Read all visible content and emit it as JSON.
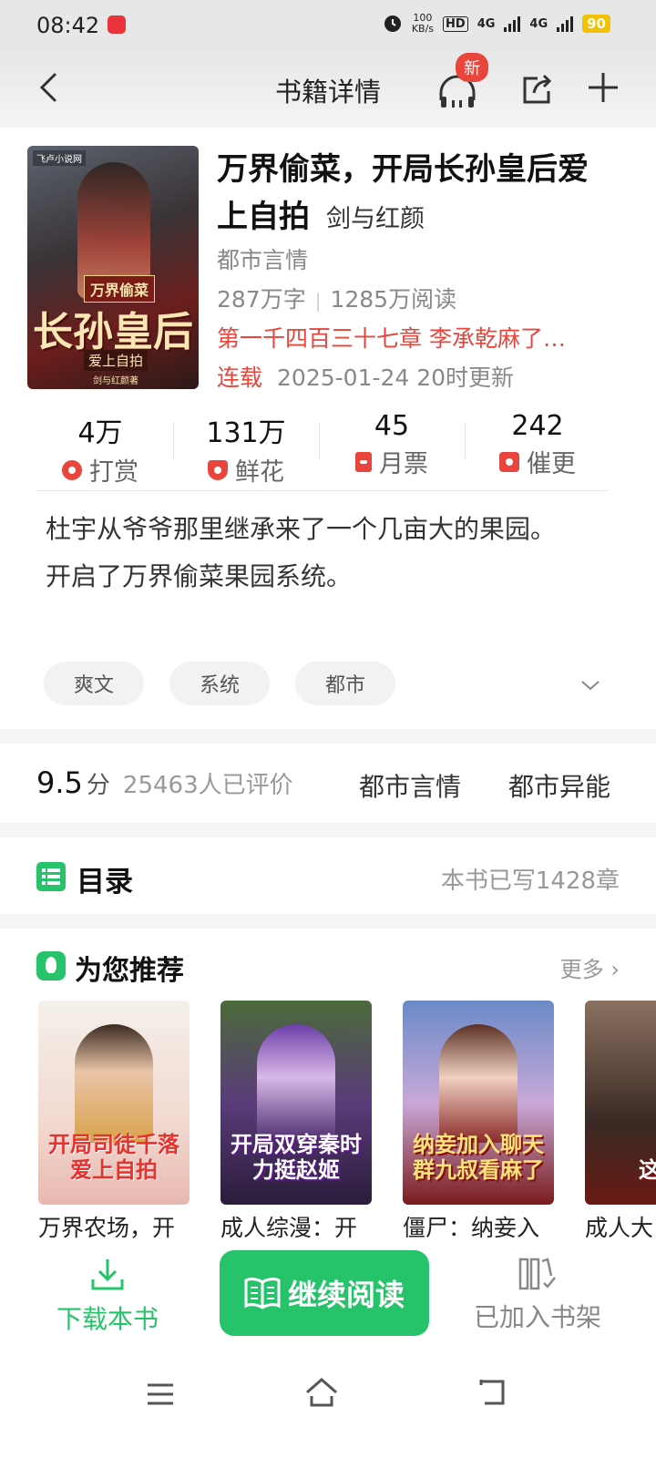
{
  "status_bar": {
    "time": "08:42",
    "net_speed_value": "100",
    "net_speed_unit": "KB/s",
    "hd": "HD",
    "sim1": "4G",
    "sim2": "4G",
    "battery": "90"
  },
  "header": {
    "title": "书籍详情",
    "new_badge": "新"
  },
  "book": {
    "cover_brand": "飞卢小说网",
    "cover_title_small": "万界偷菜",
    "cover_title_big": "长孙皇后",
    "cover_title_sub": "爱上自拍",
    "cover_author": "剑与红颜著",
    "title": "万界偷菜，开局长孙皇后爱上自拍",
    "author": "剑与红颜",
    "genre": "都市言情",
    "word_count": "287万字",
    "read_count": "1285万阅读",
    "latest_chapter": "第一千四百三十七章 李承乾麻了…",
    "serial_status": "连载",
    "update_time": "2025-01-24 20时更新"
  },
  "stats": [
    {
      "value": "4万",
      "label": "打赏",
      "icon": "reward-icon"
    },
    {
      "value": "131万",
      "label": "鲜花",
      "icon": "flower-icon"
    },
    {
      "value": "45",
      "label": "月票",
      "icon": "ticket-icon"
    },
    {
      "value": "242",
      "label": "催更",
      "icon": "urge-icon"
    }
  ],
  "intro": {
    "line1": "杜宇从爷爷那里继承来了一个几亩大的果园。",
    "line2": "开启了万界偷菜果园系统。"
  },
  "tags": [
    "爽文",
    "系统",
    "都市"
  ],
  "rating": {
    "score": "9.5",
    "unit": "分",
    "count": "25463人已评价",
    "category1": "都市言情",
    "category2": "都市异能"
  },
  "toc": {
    "label": "目录",
    "written": "本书已写1428章"
  },
  "recommend": {
    "label": "为您推荐",
    "more": "更多",
    "items": [
      {
        "title": "万界农场，开",
        "cover_text": "开局司徒千落爱上自拍"
      },
      {
        "title": "成人综漫：开",
        "cover_text": "开局双穿秦时力挺赵姬"
      },
      {
        "title": "僵尸：纳妾入",
        "cover_text": "纳妾加入聊天群九叔看麻了"
      },
      {
        "title": "成人大",
        "cover_text": "这宗"
      }
    ]
  },
  "actions": {
    "download": "下载本书",
    "read": "继续阅读",
    "shelf": "已加入书架"
  },
  "colors": {
    "accent_green": "#27c36a",
    "accent_red": "#e8453c"
  }
}
